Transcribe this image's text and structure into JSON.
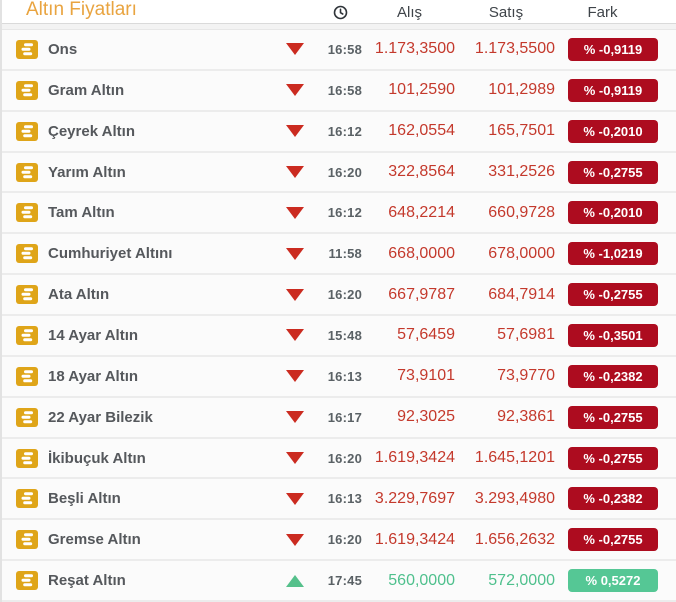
{
  "widget": {
    "title": "Altın Fiyatları",
    "columns": {
      "trend": "",
      "time_icon": "clock-icon",
      "buy": "Alış",
      "sell": "Satış",
      "diff": "Fark"
    }
  },
  "icons": {
    "row_icon": "gold-coins-icon",
    "time_header_icon": "clock-icon",
    "down_icon": "triangle-down-icon",
    "up_icon": "triangle-up-icon"
  },
  "colors": {
    "title-orange": "#e9a440",
    "gold": "#dfa519",
    "value-red": "#c4392c",
    "badge-red": "#ad0c1f",
    "tri-red": "#cb2b20",
    "value-green": "#4fc08d",
    "badge-green": "#55c795",
    "tri-green": "#55c08b",
    "border-strong": "#e2e2e2"
  },
  "rows": [
    {
      "name": "Ons",
      "trend": "down",
      "time": "16:58",
      "buy": "1.173,3500",
      "sell": "1.173,5500",
      "diff": "% -0,9119"
    },
    {
      "name": "Gram Altın",
      "trend": "down",
      "time": "16:58",
      "buy": "101,2590",
      "sell": "101,2989",
      "diff": "% -0,9119"
    },
    {
      "name": "Çeyrek Altın",
      "trend": "down",
      "time": "16:12",
      "buy": "162,0554",
      "sell": "165,7501",
      "diff": "% -0,2010"
    },
    {
      "name": "Yarım Altın",
      "trend": "down",
      "time": "16:20",
      "buy": "322,8564",
      "sell": "331,2526",
      "diff": "% -0,2755"
    },
    {
      "name": "Tam Altın",
      "trend": "down",
      "time": "16:12",
      "buy": "648,2214",
      "sell": "660,9728",
      "diff": "% -0,2010"
    },
    {
      "name": "Cumhuriyet Altını",
      "trend": "down",
      "time": "11:58",
      "buy": "668,0000",
      "sell": "678,0000",
      "diff": "% -1,0219"
    },
    {
      "name": "Ata Altın",
      "trend": "down",
      "time": "16:20",
      "buy": "667,9787",
      "sell": "684,7914",
      "diff": "% -0,2755"
    },
    {
      "name": "14 Ayar Altın",
      "trend": "down",
      "time": "15:48",
      "buy": "57,6459",
      "sell": "57,6981",
      "diff": "% -0,3501"
    },
    {
      "name": "18 Ayar Altın",
      "trend": "down",
      "time": "16:13",
      "buy": "73,9101",
      "sell": "73,9770",
      "diff": "% -0,2382"
    },
    {
      "name": "22 Ayar Bilezik",
      "trend": "down",
      "time": "16:17",
      "buy": "92,3025",
      "sell": "92,3861",
      "diff": "% -0,2755"
    },
    {
      "name": "İkibuçuk Altın",
      "trend": "down",
      "time": "16:20",
      "buy": "1.619,3424",
      "sell": "1.645,1201",
      "diff": "% -0,2755"
    },
    {
      "name": "Beşli Altın",
      "trend": "down",
      "time": "16:13",
      "buy": "3.229,7697",
      "sell": "3.293,4980",
      "diff": "% -0,2382"
    },
    {
      "name": "Gremse Altın",
      "trend": "down",
      "time": "16:20",
      "buy": "1.619,3424",
      "sell": "1.656,2632",
      "diff": "% -0,2755"
    },
    {
      "name": "Reşat Altın",
      "trend": "up",
      "time": "17:45",
      "buy": "560,0000",
      "sell": "572,0000",
      "diff": "% 0,5272"
    }
  ]
}
